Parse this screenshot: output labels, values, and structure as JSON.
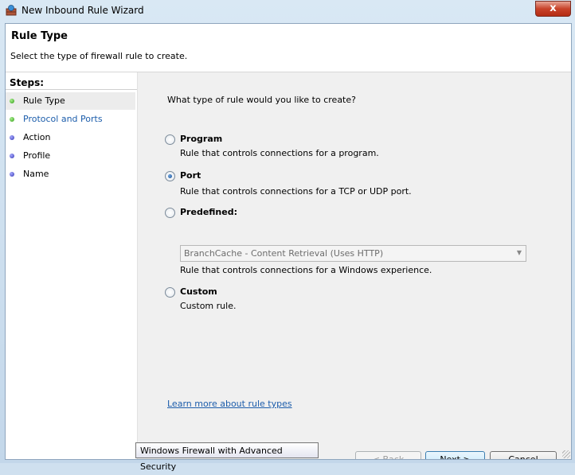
{
  "window": {
    "title": "New Inbound Rule Wizard",
    "close_glyph": "x"
  },
  "header": {
    "title": "Rule Type",
    "description": "Select the type of firewall rule to create."
  },
  "sidebar": {
    "steps_label": "Steps:",
    "items": [
      {
        "label": "Rule Type",
        "status": "green",
        "active": true
      },
      {
        "label": "Protocol and Ports",
        "status": "green",
        "active": false
      },
      {
        "label": "Action",
        "status": "blue",
        "active": false
      },
      {
        "label": "Profile",
        "status": "blue",
        "active": false
      },
      {
        "label": "Name",
        "status": "blue",
        "active": false
      }
    ]
  },
  "main": {
    "question": "What type of rule would you like to create?",
    "options": [
      {
        "label": "Program",
        "description": "Rule that controls connections for a program.",
        "selected": false
      },
      {
        "label": "Port",
        "description": "Rule that controls connections for a TCP or UDP port.",
        "selected": true
      },
      {
        "label": "Predefined:",
        "description": "Rule that controls connections for a Windows experience.",
        "selected": false
      },
      {
        "label": "Custom",
        "description": "Custom rule.",
        "selected": false
      }
    ],
    "predefined_select_value": "BranchCache - Content Retrieval (Uses HTTP)",
    "learn_more_link": "Learn more about rule types"
  },
  "buttons": {
    "back": "< Back",
    "next": "Next >",
    "cancel": "Cancel"
  },
  "tooltip": "Windows Firewall with Advanced Security",
  "colors": {
    "link": "#1c5dab",
    "step_complete": "#2f9b14",
    "step_pending": "#3437b3"
  }
}
